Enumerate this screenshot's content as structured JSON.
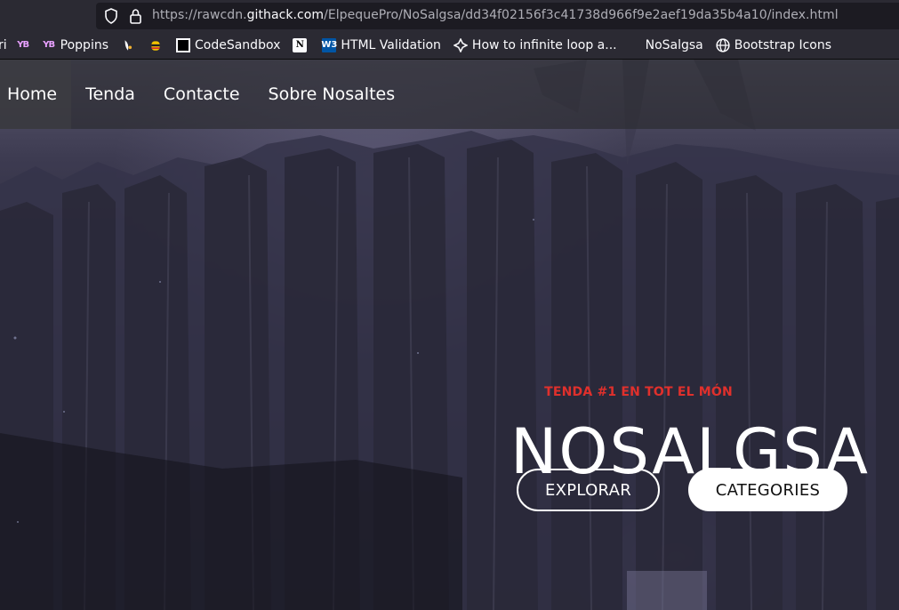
{
  "browser": {
    "url_prefix": "https://rawcdn.",
    "url_host": "githack.com",
    "url_path": "/ElpequePro/NoSalgsa/dd34f02156f3c41738d966f9e2aef19da35b4a10/index.html"
  },
  "bookmarks": [
    {
      "label": "ri",
      "icon": "bookmark-folder-icon"
    },
    {
      "label": "",
      "icon": "yb-logo-icon"
    },
    {
      "label": "Poppins",
      "icon": "yb-logo-icon"
    },
    {
      "label": "",
      "icon": "bird-icon"
    },
    {
      "label": "",
      "icon": "bee-icon"
    },
    {
      "label": "CodeSandbox",
      "icon": "codesandbox-icon"
    },
    {
      "label": "",
      "icon": "notion-icon"
    },
    {
      "label": "HTML Validation",
      "icon": "w3c-icon"
    },
    {
      "label": "How to infinite loop a...",
      "icon": "sparkle-icon"
    },
    {
      "label": "NoSalgsa",
      "icon": "blank-page-icon"
    },
    {
      "label": "Bootstrap Icons",
      "icon": "globe-icon"
    }
  ],
  "nav": {
    "items": [
      "Home",
      "Tenda",
      "Contacte",
      "Sobre Nosaltes"
    ],
    "active_index": 0
  },
  "hero": {
    "eyebrow": "TENDA #1 EN TOT EL MÓN",
    "title": "NOSALGSA",
    "explore_button": "EXPLORAR",
    "categories_button": "CATEGORIES"
  },
  "colors": {
    "accent": "#e0302c",
    "chrome_bg": "#2b2a33",
    "url_bg": "#1c1b22"
  }
}
